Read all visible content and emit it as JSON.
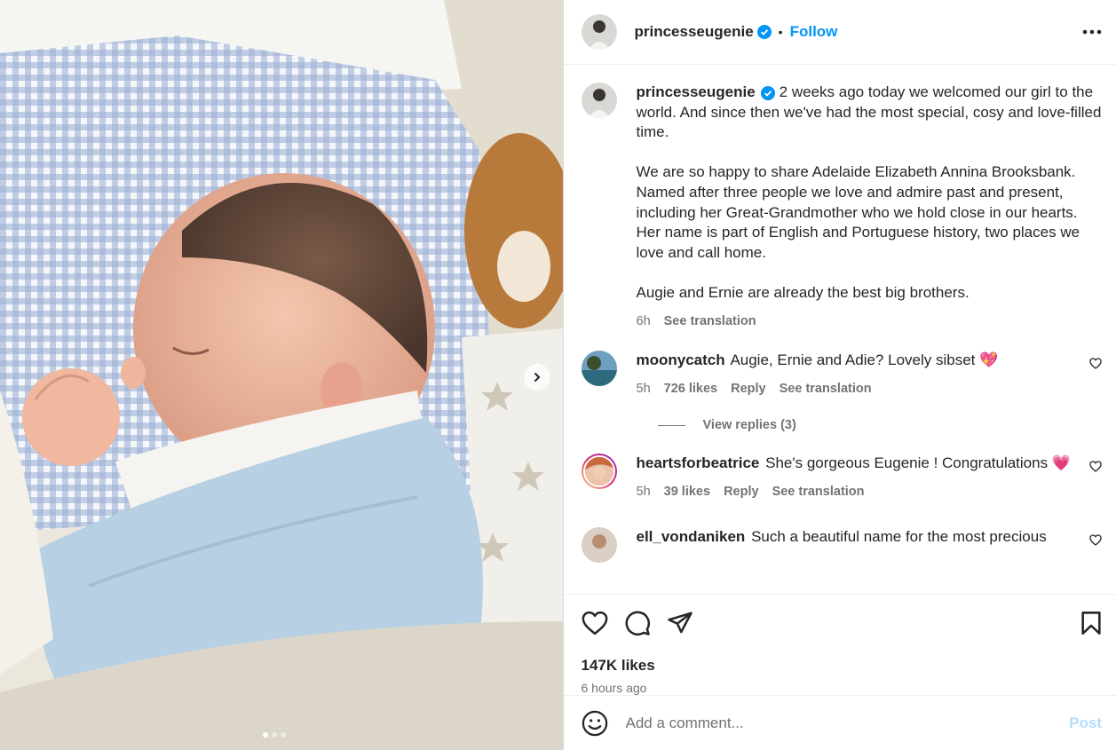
{
  "post": {
    "username": "princesseugenie",
    "follow_label": "Follow",
    "separator": "•",
    "caption": "2 weeks ago today we welcomed our girl to the world. And since then we've had the most special, cosy and love-filled time.\n\nWe are so happy to share Adelaide Elizabeth Annina Brooksbank. Named after three people we love and admire past and present, including her Great-Grandmother who we hold close in our hearts. Her name is part of English and Portuguese history, two places we love and call home.\n\nAugie and Ernie are already the best big brothers.",
    "caption_time": "6h",
    "see_translation": "See translation",
    "likes": "147K likes",
    "posted": "6 hours ago",
    "carousel": {
      "slides": 3,
      "active": 1
    }
  },
  "comments": [
    {
      "username": "moonycatch",
      "text": "Augie, Ernie and Adie? Lovely sibset",
      "emoji": "💖",
      "time": "5h",
      "likes": "726 likes",
      "reply": "Reply",
      "translate": "See translation",
      "view_replies": "View replies (3)"
    },
    {
      "username": "heartsforbeatrice",
      "text": "She's gorgeous Eugenie ! Congratulations",
      "emoji": "💗",
      "time": "5h",
      "likes": "39 likes",
      "reply": "Reply",
      "translate": "See translation"
    },
    {
      "username": "ell_vondaniken",
      "text": "Such a beautiful name for the most precious"
    }
  ],
  "add_comment": {
    "placeholder": "Add a comment...",
    "post_label": "Post"
  },
  "icons": {
    "verified": "verified-badge-icon",
    "more": "more-options-icon",
    "like": "heart-icon",
    "comment": "comment-icon",
    "share": "share-icon",
    "save": "bookmark-icon",
    "emoji": "emoji-icon",
    "next": "chevron-right-icon"
  },
  "colors": {
    "accent": "#0095f6",
    "verified": "#0095f6",
    "post_disabled": "#b2dffc",
    "muted": "#737373"
  }
}
